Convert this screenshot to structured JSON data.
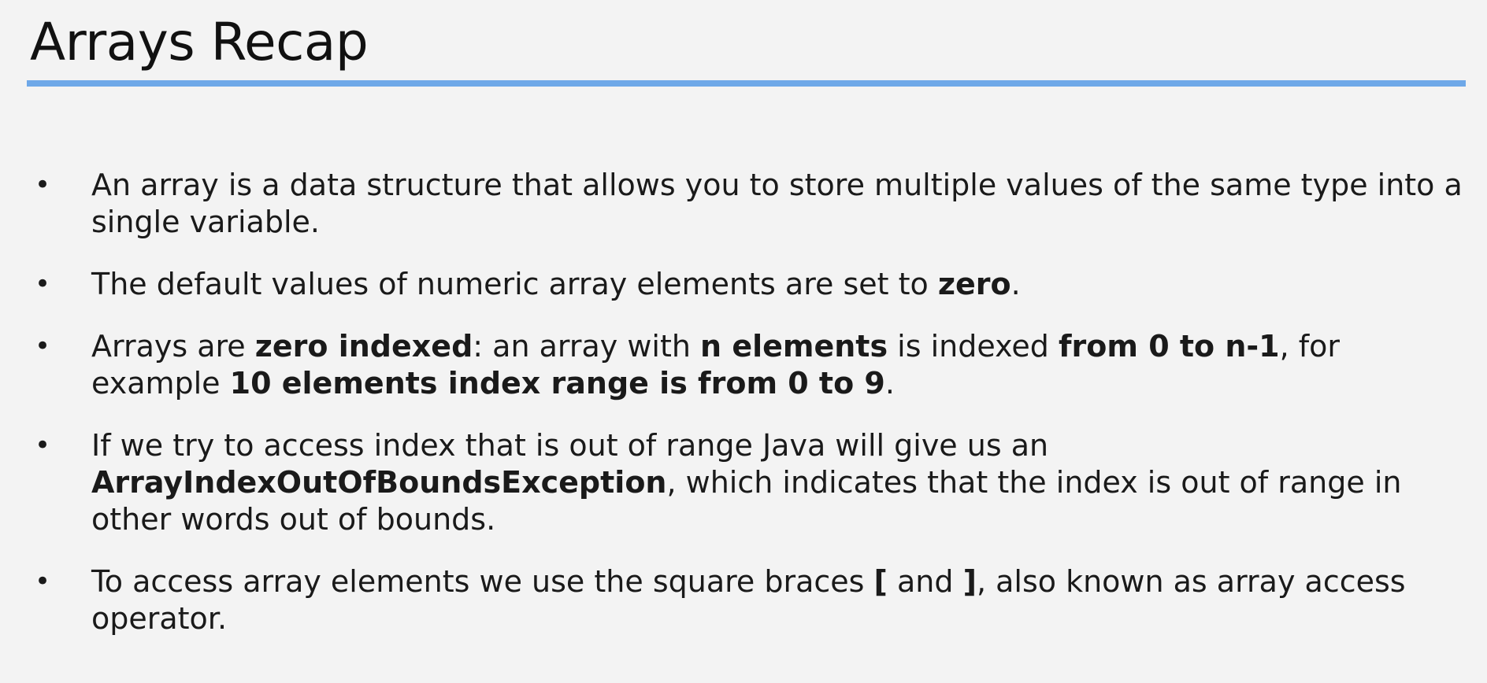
{
  "slide": {
    "title": "Arrays Recap",
    "accent_color": "#6ea8e8",
    "bullet_symbol": "•"
  },
  "bullets": [
    {
      "segments": [
        {
          "text": "An array is a data structure that allows you to store multiple values of the same type into a single variable.",
          "bold": false
        }
      ]
    },
    {
      "segments": [
        {
          "text": "The default values of numeric array elements are set to ",
          "bold": false
        },
        {
          "text": "zero",
          "bold": true
        },
        {
          "text": ".",
          "bold": false
        }
      ]
    },
    {
      "segments": [
        {
          "text": "Arrays are ",
          "bold": false
        },
        {
          "text": "zero indexed",
          "bold": true
        },
        {
          "text": ": an array with ",
          "bold": false
        },
        {
          "text": "n elements",
          "bold": true
        },
        {
          "text": " is indexed ",
          "bold": false
        },
        {
          "text": "from 0 to n-1",
          "bold": true
        },
        {
          "text": ", for example ",
          "bold": false
        },
        {
          "text": "10 elements index range is from 0 to 9",
          "bold": true
        },
        {
          "text": ".",
          "bold": false
        }
      ]
    },
    {
      "segments": [
        {
          "text": "If we try to access index that is out of range Java will give us an ",
          "bold": false
        },
        {
          "text": "ArrayIndexOutOfBoundsException",
          "bold": true
        },
        {
          "text": ", which indicates that the index is out of range in other words out of bounds.",
          "bold": false
        }
      ]
    },
    {
      "segments": [
        {
          "text": "To access array elements we use the square braces ",
          "bold": false
        },
        {
          "text": "[",
          "bold": true
        },
        {
          "text": " and ",
          "bold": false
        },
        {
          "text": "]",
          "bold": true
        },
        {
          "text": ", also known as array access operator.",
          "bold": false
        }
      ]
    }
  ]
}
